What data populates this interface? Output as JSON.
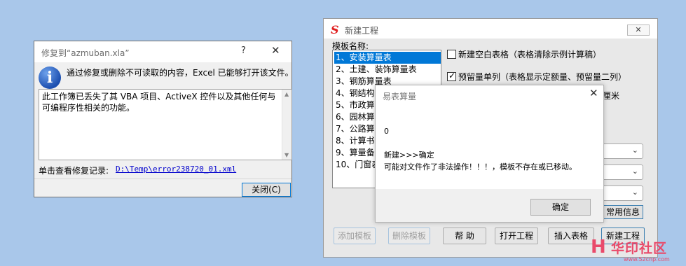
{
  "repair_dialog": {
    "title": "修复到“azmuban.xla”",
    "help": "?",
    "close": "✕",
    "message": "通过修复或删除不可读取的内容，Excel 已能够打开该文件。",
    "details": "此工作簿已丢失了其 VBA 项目、ActiveX 控件以及其他任何与可编程序性相关的功能。",
    "log_label": "单击查看修复记录:",
    "log_link": "D:\\Temp\\error238720_01.xml",
    "close_button": "关闭(C)"
  },
  "new_project": {
    "logo": "S",
    "title": "新建工程",
    "close": "✕",
    "template_label": "模板名称:",
    "templates": [
      "1、安装算量表",
      "2、土建、装饰算量表",
      "3、钢筋算量表",
      "4、钢结构",
      "5、市政算",
      "6、园林算",
      "7、公路算",
      "8、计算书",
      "9、算量备",
      "10、门窗表"
    ],
    "selected_index": 0,
    "option_blank": "新建空白表格（表格清除示例计算稿）",
    "option_blank_checked": false,
    "option_reserve": "预留量单列（表格显示定额量、预留量二列）",
    "option_reserve_checked": true,
    "unit_label": "厘米",
    "common_info_button": "常用信息",
    "buttons": {
      "add_template": "添加模板",
      "delete_template": "删除模板",
      "help": "帮 助",
      "open_project": "打开工程",
      "insert_table": "插入表格",
      "new_project": "新建工程"
    }
  },
  "message_box": {
    "title": "易表算量",
    "close": "✕",
    "line0": "0",
    "line1": "新建>>>确定",
    "line2": "可能对文件作了非法操作！！！，模板不存在或已移动。",
    "ok_button": "确定"
  },
  "watermark": {
    "icon": "H",
    "name": "华印社区",
    "url": "www.52cnp.com"
  }
}
